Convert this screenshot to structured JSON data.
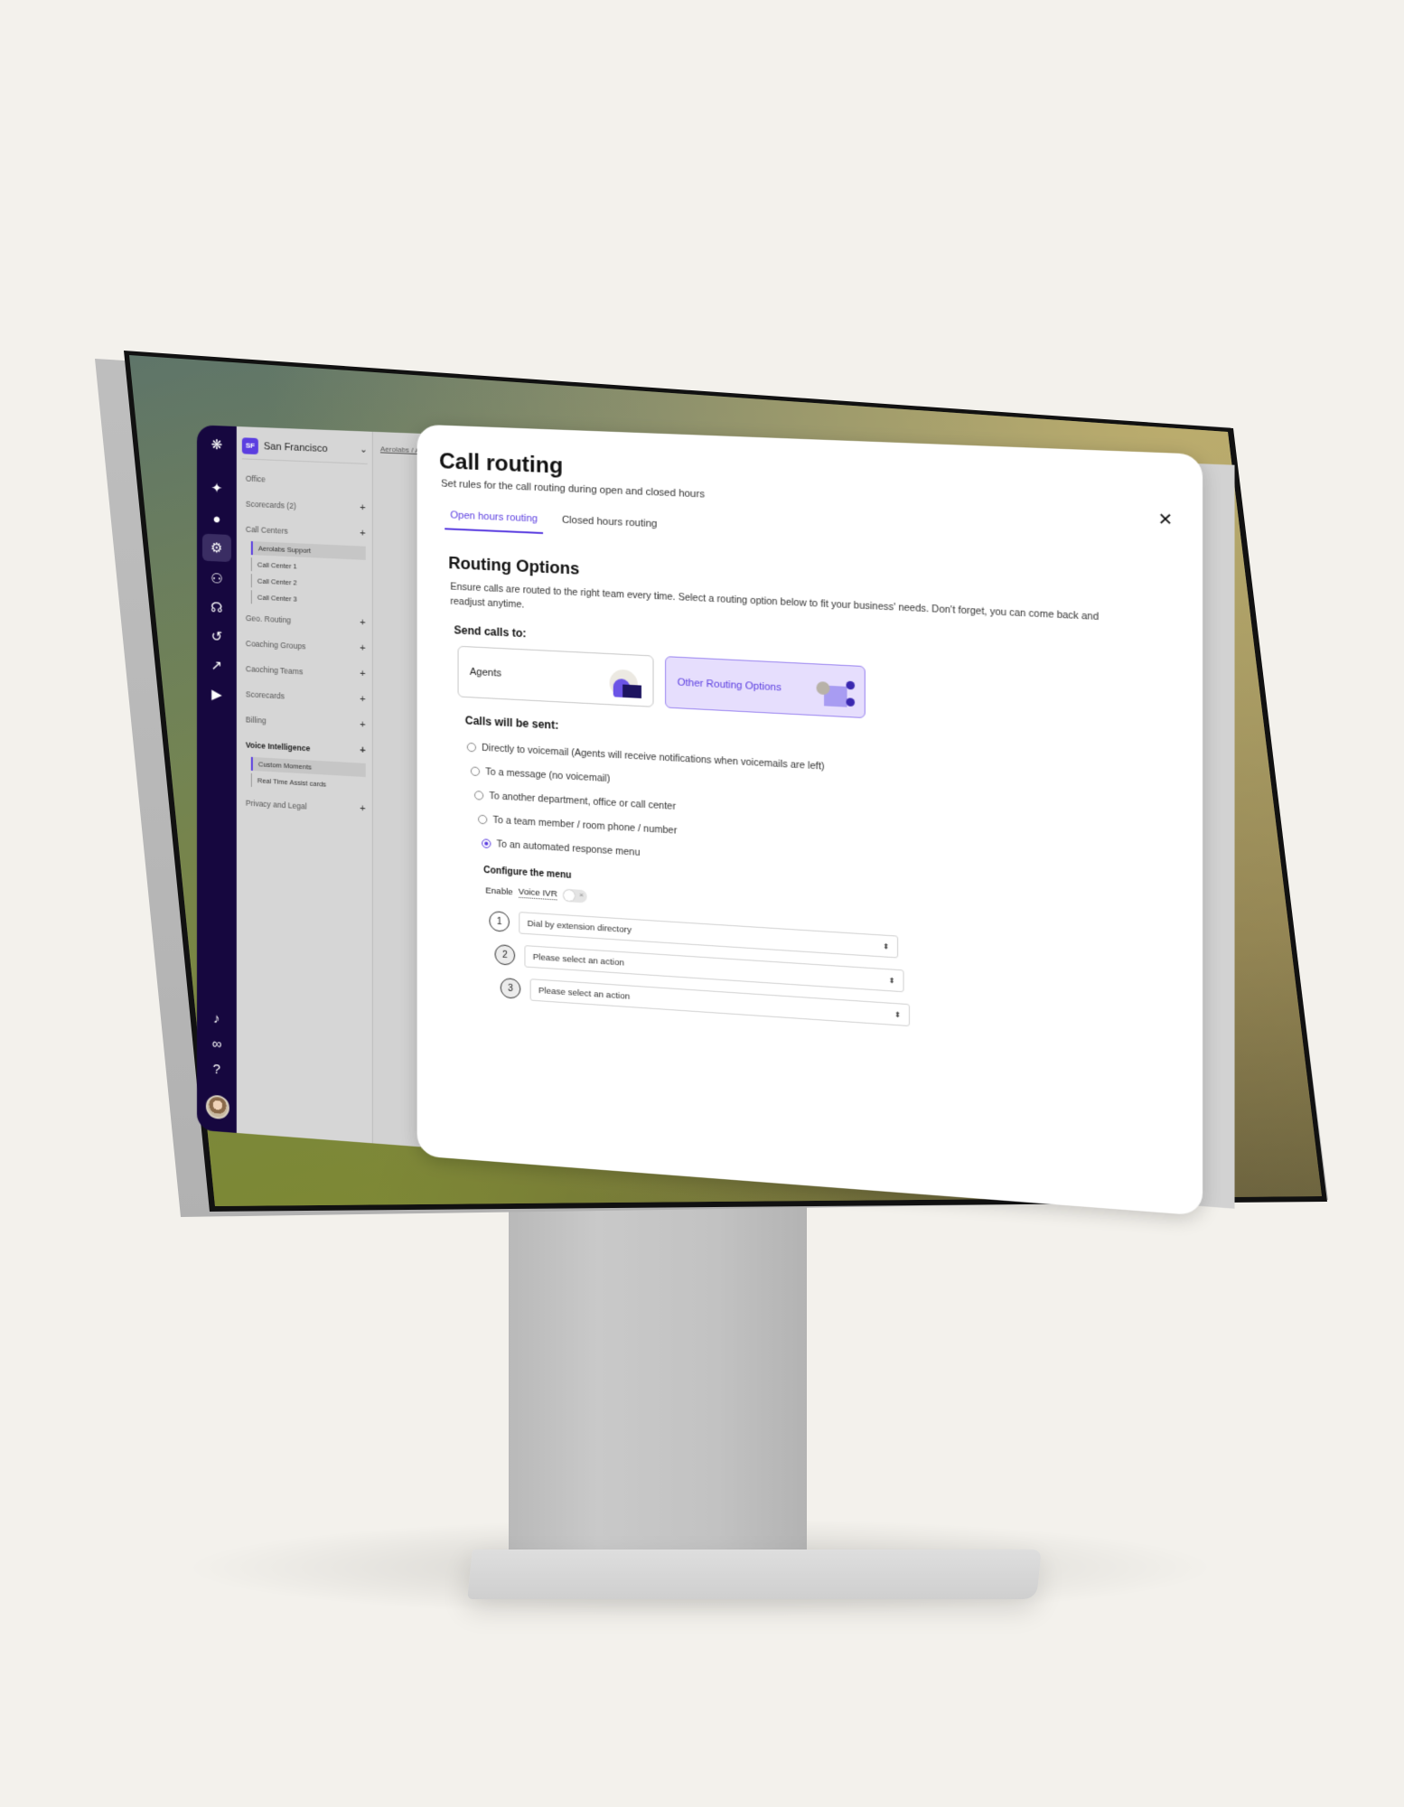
{
  "sidebar_rail": {
    "icons": [
      "logo-icon",
      "sparkle-icon",
      "user-icon",
      "gear-icon",
      "team-icon",
      "headset-icon",
      "history-icon",
      "trend-icon",
      "video-settings-icon",
      "bell-icon",
      "brand-icon",
      "help-icon"
    ],
    "active_icon": "gear-icon"
  },
  "sidebar": {
    "org_badge": "SF",
    "org_name": "San Francisco",
    "items": [
      {
        "label": "Office",
        "has_plus": false
      },
      {
        "label": "Scorecards (2)",
        "has_plus": true
      },
      {
        "label": "Call Centers",
        "has_plus": true
      },
      {
        "label": "Geo. Routing",
        "has_plus": true
      },
      {
        "label": "Coaching Groups",
        "has_plus": true
      },
      {
        "label": "Caoching Teams",
        "has_plus": true
      },
      {
        "label": "Scorecards",
        "has_plus": true
      },
      {
        "label": "Billing",
        "has_plus": true
      },
      {
        "label": "Voice Intelligence",
        "has_plus": true
      },
      {
        "label": "Privacy and Legal",
        "has_plus": true
      }
    ],
    "call_center_subitems": [
      "Aerolabs Support",
      "Call Center 1",
      "Call Center 2",
      "Call Center 3"
    ],
    "voice_intelligence_subitems": [
      "Custom Moments",
      "Real Time Assist cards"
    ],
    "plus_glyph": "+"
  },
  "breadcrumb": "Aerolabs / Ad",
  "modal": {
    "title": "Call routing",
    "subtitle": "Set rules for the call routing during open and closed hours",
    "close_glyph": "✕",
    "tabs": [
      {
        "label": "Open hours routing",
        "active": true
      },
      {
        "label": "Closed hours routing",
        "active": false
      }
    ],
    "section_title": "Routing Options",
    "section_desc": "Ensure calls are routed to the right team every time. Select a routing option below to fit your business' needs. Don't forget, you can come back and readjust anytime.",
    "send_calls_label": "Send calls to:",
    "cards": [
      {
        "label": "Agents",
        "selected": false
      },
      {
        "label": "Other Routing Options",
        "selected": true
      }
    ],
    "calls_sent_label": "Calls will be sent:",
    "radio_options": [
      {
        "label": "Directly to voicemail (Agents will receive notifications when voicemails are left)",
        "checked": false
      },
      {
        "label": "To a message (no voicemail)",
        "checked": false
      },
      {
        "label": "To another department, office or call center",
        "checked": false
      },
      {
        "label": "To a team member / room phone / number",
        "checked": false
      },
      {
        "label": "To an automated response menu",
        "checked": true
      }
    ],
    "configure_label": "Configure the menu",
    "ivr_label_prefix": "Enable",
    "ivr_label_term": "Voice IVR",
    "ivr_enabled": false,
    "ivr_toggle_glyph": "×",
    "menu_rows": [
      {
        "number": "1",
        "value": "Dial by extension directory"
      },
      {
        "number": "2",
        "value": "Please select an action"
      },
      {
        "number": "3",
        "value": "Please select an action"
      }
    ],
    "select_arrow": "⬍"
  },
  "colors": {
    "accent": "#5b3ee0",
    "rail": "#16073f",
    "selected_card_bg": "#e6defd"
  }
}
